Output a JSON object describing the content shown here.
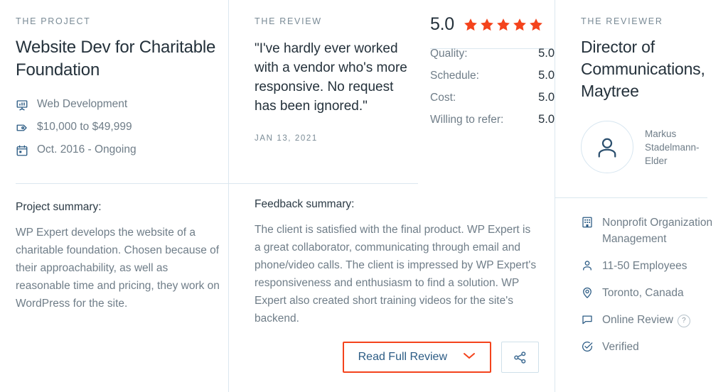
{
  "project": {
    "eyebrow": "THE PROJECT",
    "title": "Website Dev for Charitable Foundation",
    "meta": [
      {
        "icon": "presentation-chart-icon",
        "text": "Web Development"
      },
      {
        "icon": "price-tag-icon",
        "text": "$10,000 to $49,999"
      },
      {
        "icon": "calendar-icon",
        "text": "Oct. 2016 - Ongoing"
      }
    ],
    "summary_heading": "Project summary:",
    "summary_text": "WP Expert develops the website of a charitable foundation. Chosen because of their approachability, as well as reasonable time and pricing, they work on WordPress for the site."
  },
  "review": {
    "eyebrow": "THE REVIEW",
    "quote": "\"I've hardly ever worked with a vendor who's more responsive. No request has been ignored.\"",
    "date": "JAN 13, 2021",
    "feedback_heading": "Feedback summary:",
    "feedback_text": "The client is satisfied with the final product. WP Expert is a great collaborator, communicating through email and phone/video calls. The client is impressed by WP Expert's responsiveness and enthusiasm to find a solution. WP Expert also created short training videos for the site's backend."
  },
  "ratings": {
    "overall_score": "5.0",
    "stars_filled": 5,
    "star_color": "#f4431c",
    "lines": [
      {
        "label": "Quality:",
        "value": "5.0"
      },
      {
        "label": "Schedule:",
        "value": "5.0"
      },
      {
        "label": "Cost:",
        "value": "5.0"
      },
      {
        "label": "Willing to refer:",
        "value": "5.0"
      }
    ]
  },
  "actions": {
    "read_full_review_label": "Read Full Review",
    "read_full_review_border_color": "#f4431c",
    "share_icon": "share-icon"
  },
  "reviewer": {
    "eyebrow": "THE REVIEWER",
    "title": "Director of Communications, Maytree",
    "name": "Markus Stadelmann-Elder",
    "details": [
      {
        "icon": "building-icon",
        "text": "Nonprofit Organization Management",
        "help": false
      },
      {
        "icon": "person-icon",
        "text": "11-50 Employees",
        "help": false
      },
      {
        "icon": "location-pin-icon",
        "text": "Toronto, Canada",
        "help": false
      },
      {
        "icon": "speech-bubble-icon",
        "text": "Online Review",
        "help": true,
        "help_label": "?"
      },
      {
        "icon": "check-circle-icon",
        "text": "Verified",
        "help": false
      }
    ]
  }
}
